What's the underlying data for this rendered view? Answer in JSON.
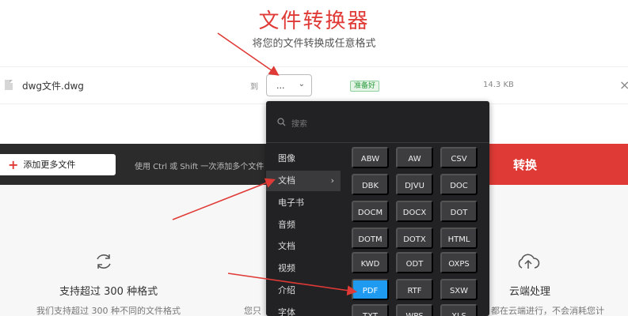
{
  "header": {
    "title": "文件转换器",
    "subtitle": "将您的文件转换成任意格式"
  },
  "file_row": {
    "file_name": "dwg文件.dwg",
    "to_label": "到",
    "select_value": "...",
    "status": "准备好",
    "size": "14.3 KB",
    "close": "×"
  },
  "actions": {
    "add_files": "添加更多文件",
    "hint": "使用 Ctrl 或 Shift 一次添加多个文件",
    "convert": "转换"
  },
  "dropdown": {
    "search_placeholder": "搜索",
    "categories": [
      "图像",
      "文档",
      "电子书",
      "音频",
      "文档",
      "视频",
      "介绍",
      "字体"
    ],
    "active_category": "文档",
    "formats": [
      "ABW",
      "AW",
      "CSV",
      "DBK",
      "DJVU",
      "DOC",
      "DOCM",
      "DOCX",
      "DOT",
      "DOTM",
      "DOTX",
      "HTML",
      "KWD",
      "ODT",
      "OXPS",
      "PDF",
      "RTF",
      "SXW",
      "TXT",
      "WPS",
      "XLS"
    ],
    "selected_format": "PDF"
  },
  "features": [
    {
      "title": "支持超过 300 种格式",
      "desc": "我们支持超过 300 种不同的文件格式",
      "icon": "refresh-icon"
    },
    {
      "title": "云端处理",
      "desc": "都在云端进行，不会消耗您计",
      "icon": "cloud-upload-icon"
    }
  ],
  "feature_partial_text": "您只",
  "colors": {
    "brand_red": "#e03a36",
    "dropdown_bg": "#222224",
    "format_bg": "#3d3d40",
    "selected_blue": "#1e9bf0",
    "status_green": "#2a9a3e"
  }
}
